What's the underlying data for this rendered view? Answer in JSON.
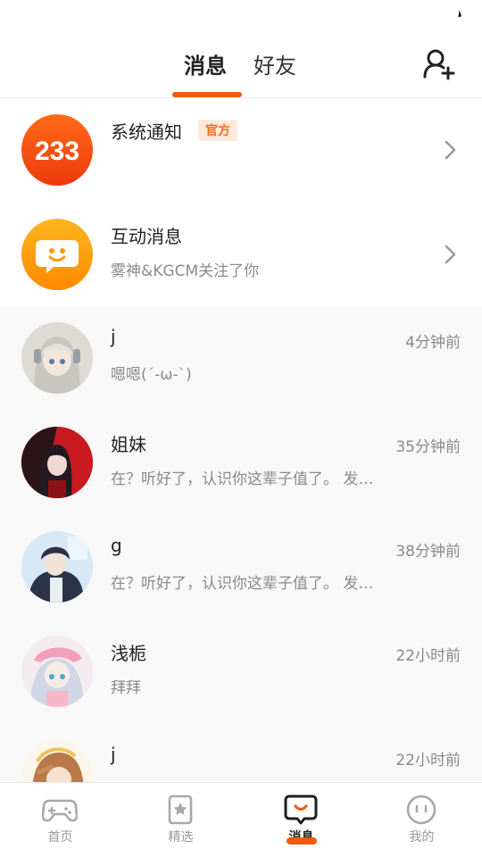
{
  "header": {
    "tabs": [
      {
        "label": "消息",
        "active": true
      },
      {
        "label": "好友",
        "active": false
      }
    ],
    "add_friend_icon": "add-person-icon"
  },
  "colors": {
    "accent": "#f25a12",
    "badge_bg": "#fde9dc",
    "badge_text": "#f26b1e"
  },
  "system_rows": [
    {
      "title": "系统通知",
      "badge": "官方",
      "subtitle": "",
      "avatar_text": "233",
      "icon": "chevron-right-icon"
    },
    {
      "title": "互动消息",
      "subtitle": "雾神&KGCM关注了你",
      "avatar_icon": "smiley-chat-icon",
      "icon": "chevron-right-icon"
    }
  ],
  "conversations": [
    {
      "name": "j",
      "message": "嗯嗯(´-ω-`)",
      "time": "4分钟前"
    },
    {
      "name": "姐妹",
      "message": "在？听好了，认识你这辈子值了。 发…",
      "time": "35分钟前"
    },
    {
      "name": "g",
      "message": "在？听好了，认识你这辈子值了。 发…",
      "time": "38分钟前"
    },
    {
      "name": "浅栀",
      "message": "拜拜",
      "time": "22小时前"
    },
    {
      "name": "j",
      "message": "",
      "time": "22小时前"
    }
  ],
  "bottom_nav": [
    {
      "label": "首页",
      "icon": "gamepad-icon",
      "active": false
    },
    {
      "label": "精选",
      "icon": "star-bookmark-icon",
      "active": false
    },
    {
      "label": "消息",
      "icon": "message-bubble-icon",
      "active": true
    },
    {
      "label": "我的",
      "icon": "face-icon",
      "active": false
    }
  ]
}
